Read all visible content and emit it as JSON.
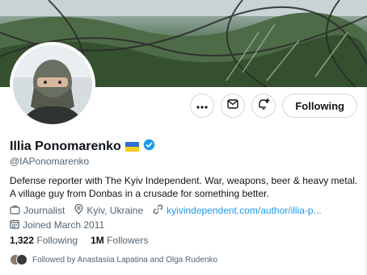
{
  "profile": {
    "name": "Illia Ponomarenko",
    "handle": "@IAPonomarenko",
    "bio": "Defense reporter with The Kyiv Independent. War, weapons, beer & heavy metal. A village guy from Donbas in a crusade for something better.",
    "profession": "Journalist",
    "location": "Kyiv, Ukraine",
    "website": "kyivindependent.com/author/illia-p...",
    "joined": "Joined March 2011",
    "verified": true
  },
  "actions": {
    "follow_label": "Following",
    "more_icon": "more-icon",
    "message_icon": "mail-icon",
    "notify_icon": "bell-plus-icon"
  },
  "stats": {
    "following_count": "1,322",
    "following_label": "Following",
    "followers_count": "1M",
    "followers_label": "Followers"
  },
  "followed_by": {
    "text": "Followed by Anastasiia Lapatina and Olga Rudenko"
  },
  "colors": {
    "link": "#1d9bf0",
    "verified": "#1d9bf0",
    "secondary_text": "#536471",
    "flag_blue": "#2f6fd6",
    "flag_yellow": "#f5cc1f"
  }
}
